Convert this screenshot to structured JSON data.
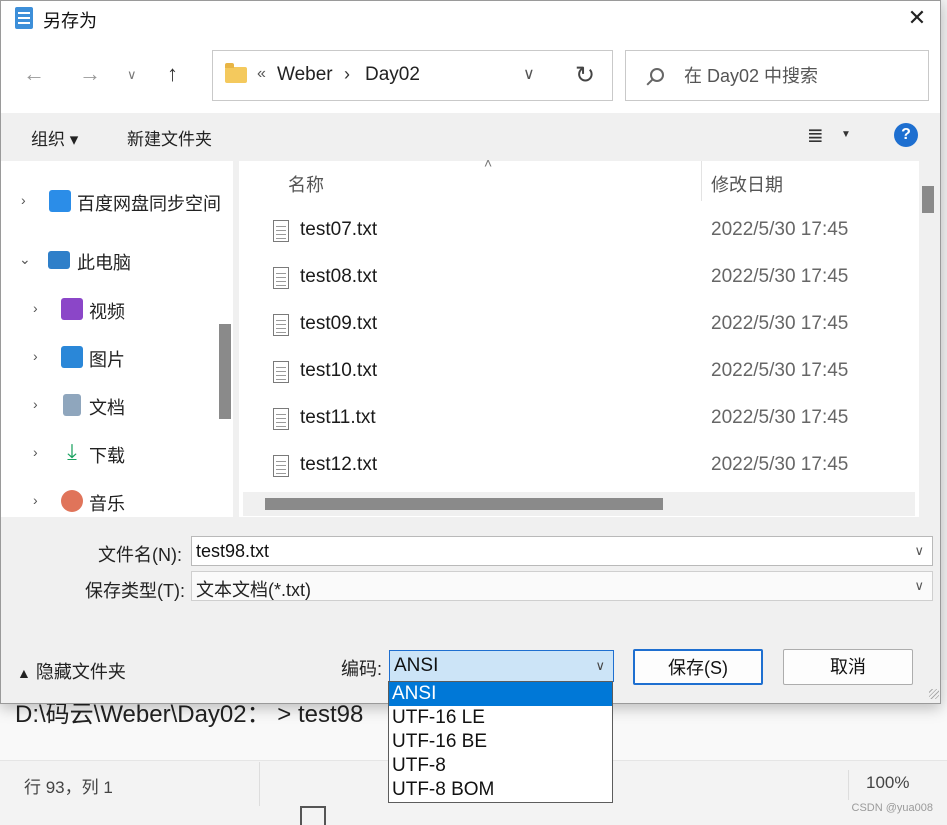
{
  "dialog": {
    "title": "另存为",
    "close_label": "✕"
  },
  "nav": {
    "back": "←",
    "forward": "→",
    "recent": "∨",
    "up": "↑",
    "breadcrumb": [
      "Weber",
      "Day02"
    ],
    "breadcrumb_prefix": "«",
    "breadcrumb_separator": "›",
    "search_placeholder": "在 Day02 中搜索"
  },
  "toolbar": {
    "organize_label": "组织 ▾",
    "new_folder_label": "新建文件夹",
    "view_icon": "≣",
    "view_caret": "▼",
    "help_label": "?"
  },
  "sidebar": {
    "items": [
      {
        "label": "百度网盘同步空间",
        "icon": "baidu-netdisk-icon",
        "expanded": false,
        "indent": 0
      },
      {
        "label": "此电脑",
        "icon": "computer-icon",
        "expanded": true,
        "indent": 0
      },
      {
        "label": "视频",
        "icon": "video-icon",
        "expanded": false,
        "indent": 1
      },
      {
        "label": "图片",
        "icon": "picture-icon",
        "expanded": false,
        "indent": 1
      },
      {
        "label": "文档",
        "icon": "document-icon",
        "expanded": false,
        "indent": 1
      },
      {
        "label": "下载",
        "icon": "download-icon",
        "expanded": false,
        "indent": 1
      },
      {
        "label": "音乐",
        "icon": "music-icon",
        "expanded": false,
        "indent": 1
      }
    ]
  },
  "files": {
    "columns": {
      "name": "名称",
      "modified": "修改日期"
    },
    "rows": [
      {
        "name": "test07.txt",
        "modified": "2022/5/30 17:45"
      },
      {
        "name": "test08.txt",
        "modified": "2022/5/30 17:45"
      },
      {
        "name": "test09.txt",
        "modified": "2022/5/30 17:45"
      },
      {
        "name": "test10.txt",
        "modified": "2022/5/30 17:45"
      },
      {
        "name": "test11.txt",
        "modified": "2022/5/30 17:45"
      },
      {
        "name": "test12.txt",
        "modified": "2022/5/30 17:45"
      }
    ]
  },
  "form": {
    "filename_label": "文件名(N):",
    "filename_value": "test98.txt",
    "filetype_label": "保存类型(T):",
    "filetype_value": "文本文档(*.txt)",
    "hide_folders_label": "隐藏文件夹",
    "encoding_label": "编码:",
    "encoding_value": "ANSI",
    "encoding_options": [
      "ANSI",
      "UTF-16 LE",
      "UTF-16 BE",
      "UTF-8",
      "UTF-8 BOM"
    ],
    "save_label": "保存(S)",
    "cancel_label": "取消"
  },
  "background": {
    "path_text": "D:\\码云\\Weber\\Day02： > test98",
    "status_position": "行 93，列 1",
    "status_zoom": "100%",
    "watermark": "CSDN @yua008"
  },
  "colors": {
    "accent": "#0078d7",
    "selection_bg": "#cce4f7",
    "help_blue": "#1e6fd0"
  }
}
